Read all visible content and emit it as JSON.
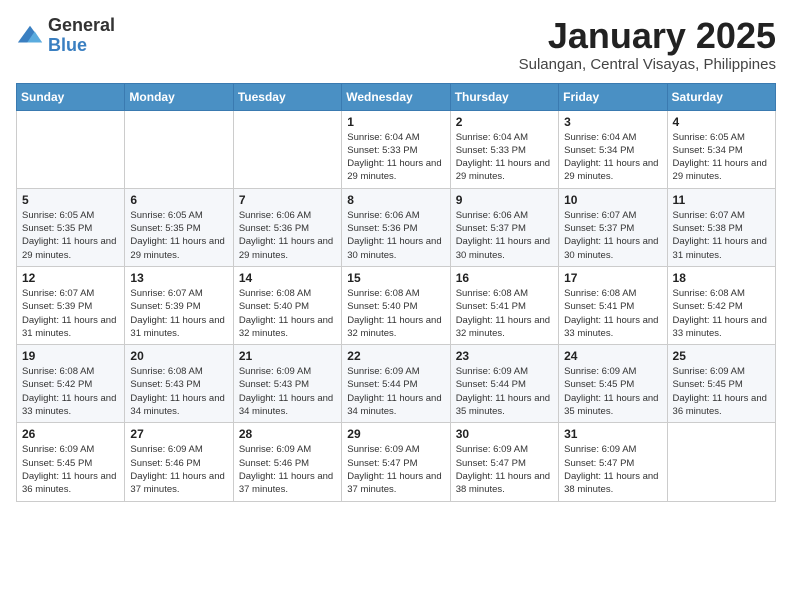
{
  "logo": {
    "general": "General",
    "blue": "Blue"
  },
  "header": {
    "month": "January 2025",
    "location": "Sulangan, Central Visayas, Philippines"
  },
  "weekdays": [
    "Sunday",
    "Monday",
    "Tuesday",
    "Wednesday",
    "Thursday",
    "Friday",
    "Saturday"
  ],
  "weeks": [
    [
      {
        "day": "",
        "sunrise": "",
        "sunset": "",
        "daylight": ""
      },
      {
        "day": "",
        "sunrise": "",
        "sunset": "",
        "daylight": ""
      },
      {
        "day": "",
        "sunrise": "",
        "sunset": "",
        "daylight": ""
      },
      {
        "day": "1",
        "sunrise": "Sunrise: 6:04 AM",
        "sunset": "Sunset: 5:33 PM",
        "daylight": "Daylight: 11 hours and 29 minutes."
      },
      {
        "day": "2",
        "sunrise": "Sunrise: 6:04 AM",
        "sunset": "Sunset: 5:33 PM",
        "daylight": "Daylight: 11 hours and 29 minutes."
      },
      {
        "day": "3",
        "sunrise": "Sunrise: 6:04 AM",
        "sunset": "Sunset: 5:34 PM",
        "daylight": "Daylight: 11 hours and 29 minutes."
      },
      {
        "day": "4",
        "sunrise": "Sunrise: 6:05 AM",
        "sunset": "Sunset: 5:34 PM",
        "daylight": "Daylight: 11 hours and 29 minutes."
      }
    ],
    [
      {
        "day": "5",
        "sunrise": "Sunrise: 6:05 AM",
        "sunset": "Sunset: 5:35 PM",
        "daylight": "Daylight: 11 hours and 29 minutes."
      },
      {
        "day": "6",
        "sunrise": "Sunrise: 6:05 AM",
        "sunset": "Sunset: 5:35 PM",
        "daylight": "Daylight: 11 hours and 29 minutes."
      },
      {
        "day": "7",
        "sunrise": "Sunrise: 6:06 AM",
        "sunset": "Sunset: 5:36 PM",
        "daylight": "Daylight: 11 hours and 29 minutes."
      },
      {
        "day": "8",
        "sunrise": "Sunrise: 6:06 AM",
        "sunset": "Sunset: 5:36 PM",
        "daylight": "Daylight: 11 hours and 30 minutes."
      },
      {
        "day": "9",
        "sunrise": "Sunrise: 6:06 AM",
        "sunset": "Sunset: 5:37 PM",
        "daylight": "Daylight: 11 hours and 30 minutes."
      },
      {
        "day": "10",
        "sunrise": "Sunrise: 6:07 AM",
        "sunset": "Sunset: 5:37 PM",
        "daylight": "Daylight: 11 hours and 30 minutes."
      },
      {
        "day": "11",
        "sunrise": "Sunrise: 6:07 AM",
        "sunset": "Sunset: 5:38 PM",
        "daylight": "Daylight: 11 hours and 31 minutes."
      }
    ],
    [
      {
        "day": "12",
        "sunrise": "Sunrise: 6:07 AM",
        "sunset": "Sunset: 5:39 PM",
        "daylight": "Daylight: 11 hours and 31 minutes."
      },
      {
        "day": "13",
        "sunrise": "Sunrise: 6:07 AM",
        "sunset": "Sunset: 5:39 PM",
        "daylight": "Daylight: 11 hours and 31 minutes."
      },
      {
        "day": "14",
        "sunrise": "Sunrise: 6:08 AM",
        "sunset": "Sunset: 5:40 PM",
        "daylight": "Daylight: 11 hours and 32 minutes."
      },
      {
        "day": "15",
        "sunrise": "Sunrise: 6:08 AM",
        "sunset": "Sunset: 5:40 PM",
        "daylight": "Daylight: 11 hours and 32 minutes."
      },
      {
        "day": "16",
        "sunrise": "Sunrise: 6:08 AM",
        "sunset": "Sunset: 5:41 PM",
        "daylight": "Daylight: 11 hours and 32 minutes."
      },
      {
        "day": "17",
        "sunrise": "Sunrise: 6:08 AM",
        "sunset": "Sunset: 5:41 PM",
        "daylight": "Daylight: 11 hours and 33 minutes."
      },
      {
        "day": "18",
        "sunrise": "Sunrise: 6:08 AM",
        "sunset": "Sunset: 5:42 PM",
        "daylight": "Daylight: 11 hours and 33 minutes."
      }
    ],
    [
      {
        "day": "19",
        "sunrise": "Sunrise: 6:08 AM",
        "sunset": "Sunset: 5:42 PM",
        "daylight": "Daylight: 11 hours and 33 minutes."
      },
      {
        "day": "20",
        "sunrise": "Sunrise: 6:08 AM",
        "sunset": "Sunset: 5:43 PM",
        "daylight": "Daylight: 11 hours and 34 minutes."
      },
      {
        "day": "21",
        "sunrise": "Sunrise: 6:09 AM",
        "sunset": "Sunset: 5:43 PM",
        "daylight": "Daylight: 11 hours and 34 minutes."
      },
      {
        "day": "22",
        "sunrise": "Sunrise: 6:09 AM",
        "sunset": "Sunset: 5:44 PM",
        "daylight": "Daylight: 11 hours and 34 minutes."
      },
      {
        "day": "23",
        "sunrise": "Sunrise: 6:09 AM",
        "sunset": "Sunset: 5:44 PM",
        "daylight": "Daylight: 11 hours and 35 minutes."
      },
      {
        "day": "24",
        "sunrise": "Sunrise: 6:09 AM",
        "sunset": "Sunset: 5:45 PM",
        "daylight": "Daylight: 11 hours and 35 minutes."
      },
      {
        "day": "25",
        "sunrise": "Sunrise: 6:09 AM",
        "sunset": "Sunset: 5:45 PM",
        "daylight": "Daylight: 11 hours and 36 minutes."
      }
    ],
    [
      {
        "day": "26",
        "sunrise": "Sunrise: 6:09 AM",
        "sunset": "Sunset: 5:45 PM",
        "daylight": "Daylight: 11 hours and 36 minutes."
      },
      {
        "day": "27",
        "sunrise": "Sunrise: 6:09 AM",
        "sunset": "Sunset: 5:46 PM",
        "daylight": "Daylight: 11 hours and 37 minutes."
      },
      {
        "day": "28",
        "sunrise": "Sunrise: 6:09 AM",
        "sunset": "Sunset: 5:46 PM",
        "daylight": "Daylight: 11 hours and 37 minutes."
      },
      {
        "day": "29",
        "sunrise": "Sunrise: 6:09 AM",
        "sunset": "Sunset: 5:47 PM",
        "daylight": "Daylight: 11 hours and 37 minutes."
      },
      {
        "day": "30",
        "sunrise": "Sunrise: 6:09 AM",
        "sunset": "Sunset: 5:47 PM",
        "daylight": "Daylight: 11 hours and 38 minutes."
      },
      {
        "day": "31",
        "sunrise": "Sunrise: 6:09 AM",
        "sunset": "Sunset: 5:47 PM",
        "daylight": "Daylight: 11 hours and 38 minutes."
      },
      {
        "day": "",
        "sunrise": "",
        "sunset": "",
        "daylight": ""
      }
    ]
  ]
}
